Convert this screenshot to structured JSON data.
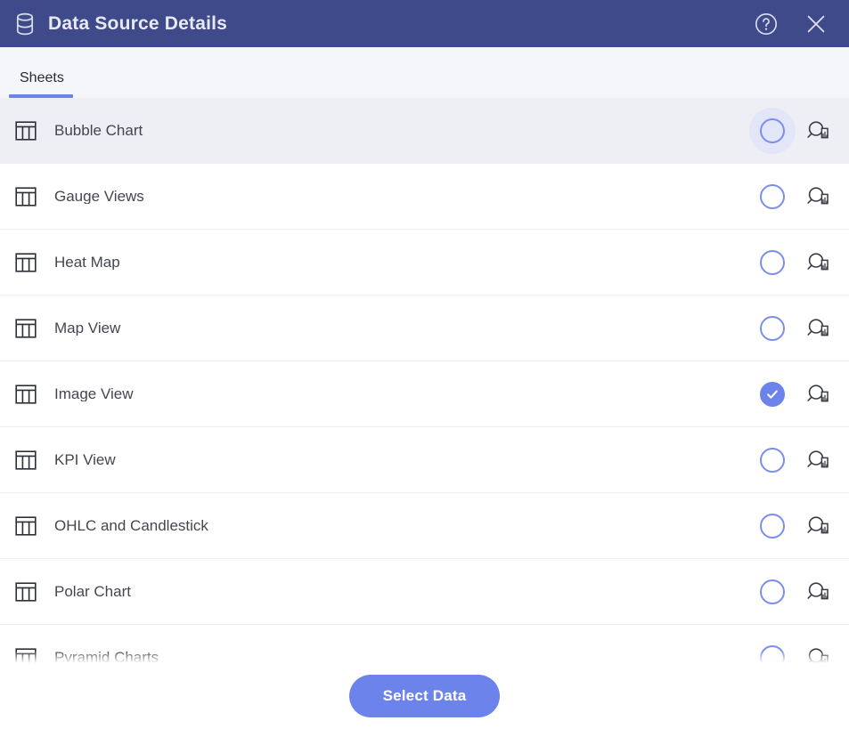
{
  "header": {
    "title": "Data Source Details",
    "icon": "database-icon",
    "background_color": "#3F4A8A",
    "help_label": "Help",
    "help_icon": "help-circle-icon",
    "close_label": "Close",
    "close_icon": "close-icon"
  },
  "tabs": [
    {
      "label": "Sheets",
      "active": true
    }
  ],
  "accent_color": "#6D83EC",
  "list": {
    "row_icon": "table-icon",
    "preview_icon": "search-chart-icon",
    "rows": [
      {
        "label": "Bubble Chart",
        "selected": false,
        "highlighted": true,
        "hovered": true
      },
      {
        "label": "Gauge Views",
        "selected": false,
        "highlighted": false,
        "hovered": false
      },
      {
        "label": "Heat Map",
        "selected": false,
        "highlighted": false,
        "hovered": false
      },
      {
        "label": "Map View",
        "selected": false,
        "highlighted": false,
        "hovered": false
      },
      {
        "label": "Image View",
        "selected": true,
        "highlighted": false,
        "hovered": false
      },
      {
        "label": "KPI View",
        "selected": false,
        "highlighted": false,
        "hovered": false
      },
      {
        "label": "OHLC and Candlestick",
        "selected": false,
        "highlighted": false,
        "hovered": false
      },
      {
        "label": "Polar Chart",
        "selected": false,
        "highlighted": false,
        "hovered": false
      },
      {
        "label": "Pyramid Charts",
        "selected": false,
        "highlighted": false,
        "hovered": false
      }
    ]
  },
  "footer": {
    "select_data_label": "Select Data"
  }
}
